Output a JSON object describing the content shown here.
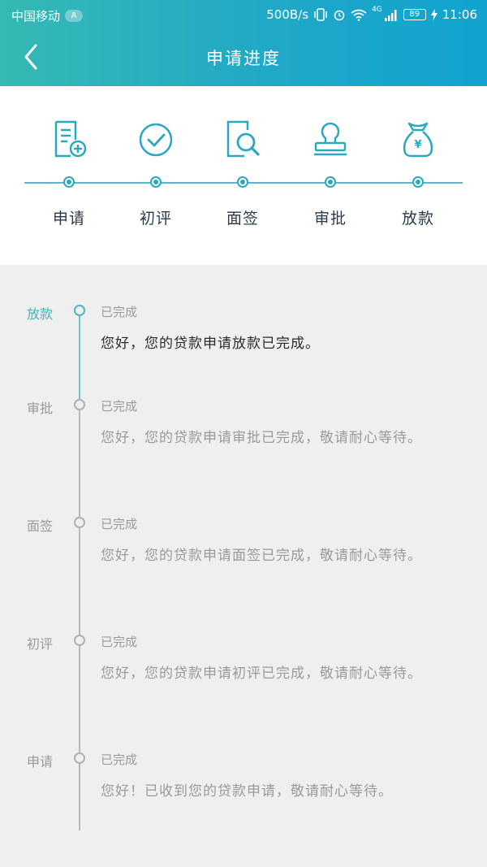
{
  "status_bar": {
    "carrier": "中国移动",
    "carrier_badge": "A",
    "speed": "500B/s",
    "network": "4G",
    "battery": "89",
    "time": "11:06"
  },
  "header": {
    "title": "申请进度"
  },
  "steps": [
    {
      "label": "申请",
      "icon": "document-add-icon"
    },
    {
      "label": "初评",
      "icon": "check-circle-icon"
    },
    {
      "label": "面签",
      "icon": "search-document-icon"
    },
    {
      "label": "审批",
      "icon": "stamp-icon"
    },
    {
      "label": "放款",
      "icon": "money-bag-icon"
    }
  ],
  "timeline": [
    {
      "name": "放款",
      "state": "已完成",
      "message": "您好，您的贷款申请放款已完成。",
      "active": true
    },
    {
      "name": "审批",
      "state": "已完成",
      "message": "您好，您的贷款申请审批已完成，敬请耐心等待。",
      "active": false
    },
    {
      "name": "面签",
      "state": "已完成",
      "message": "您好，您的贷款申请面签已完成，敬请耐心等待。",
      "active": false
    },
    {
      "name": "初评",
      "state": "已完成",
      "message": "您好，您的贷款申请初评已完成，敬请耐心等待。",
      "active": false
    },
    {
      "name": "申请",
      "state": "已完成",
      "message": "您好！已收到您的贷款申请，敬请耐心等待。",
      "active": false
    }
  ],
  "colors": {
    "accent": "#2aa8c0",
    "header_start": "#35b9b3",
    "header_end": "#11a3d0"
  }
}
